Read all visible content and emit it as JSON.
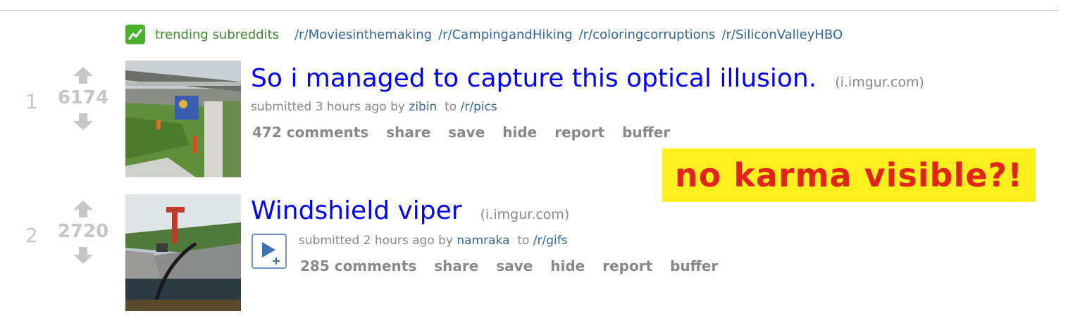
{
  "trending": {
    "icon": "trending-chart-icon",
    "label": "trending subreddits",
    "links": [
      "/r/Moviesinthemaking",
      "/r/CampingandHiking",
      "/r/coloringcorruptions",
      "/r/SiliconValleyHBO"
    ]
  },
  "posts": [
    {
      "rank": "1",
      "score": "6174",
      "title": "So i managed to capture this optical illusion.",
      "domain": "(i.imgur.com)",
      "tagline_prefix": "submitted 3 hours ago by",
      "author": "zibin",
      "tagline_to": "to",
      "subreddit": "/r/pics",
      "buttons": [
        "472 comments",
        "share",
        "save",
        "hide",
        "report",
        "buffer"
      ]
    },
    {
      "rank": "2",
      "score": "2720",
      "title": "Windshield viper",
      "domain": "(i.imgur.com)",
      "tagline_prefix": "submitted 2 hours ago by",
      "author": "namraka",
      "tagline_to": "to",
      "subreddit": "/r/gifs",
      "buttons": [
        "285 comments",
        "share",
        "save",
        "hide",
        "report",
        "buffer"
      ],
      "expando_icon": "play-plus-icon"
    }
  ],
  "annotation": {
    "text": "no karma visible?!",
    "background": "#ffef1e",
    "color": "#e2231a"
  },
  "colors": {
    "title_link": "#0000ff",
    "meta_link": "#336699",
    "muted": "#888888",
    "score": "#c6c6c6",
    "trending_green": "#4caf2e"
  }
}
